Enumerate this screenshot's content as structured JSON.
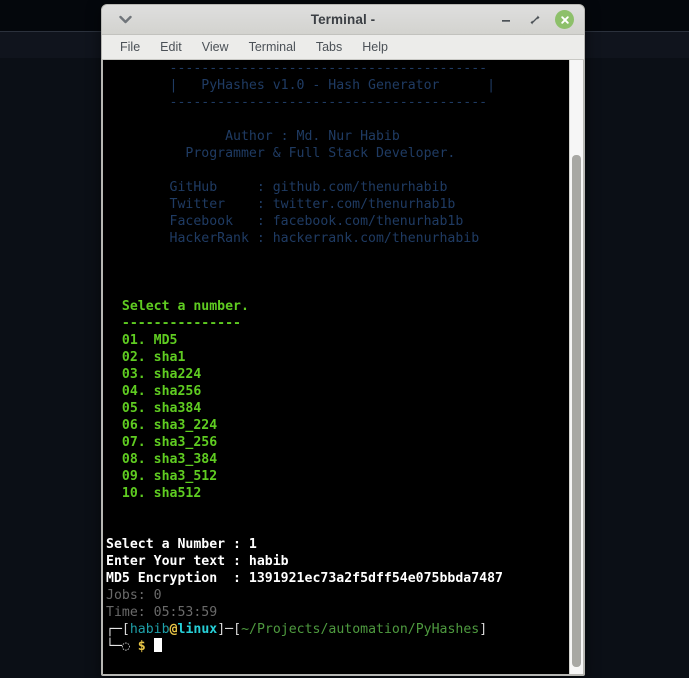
{
  "window": {
    "title": "Terminal -",
    "menu_icon": "chevron-down-icon",
    "buttons": {
      "minimize": "–",
      "maximize": "⤨",
      "close": "✕"
    }
  },
  "menubar": {
    "items": [
      {
        "label": "File"
      },
      {
        "label": "Edit"
      },
      {
        "label": "View"
      },
      {
        "label": "Terminal"
      },
      {
        "label": "Tabs"
      },
      {
        "label": "Help"
      }
    ]
  },
  "terminal": {
    "banner": {
      "rule_top": "        ----------------------------------------",
      "title_line": "        |   PyHashes v1.0 - Hash Generator      |",
      "rule_bottom": "        ----------------------------------------",
      "author": "               Author : Md. Nur Habib",
      "role": "          Programmer & Full Stack Developer."
    },
    "links": [
      {
        "label": "        GitHub     : ",
        "value": "github.com/thenurhabib"
      },
      {
        "label": "        Twitter    : ",
        "value": "twitter.com/thenurhab1b"
      },
      {
        "label": "        Facebook   : ",
        "value": "facebook.com/thenurhab1b"
      },
      {
        "label": "        HackerRank : ",
        "value": "hackerrank.com/thenurhabib"
      }
    ],
    "menu": {
      "heading": "  Select a number.",
      "rule": "  ---------------",
      "options": [
        "  01. MD5",
        "  02. sha1",
        "  03. sha224",
        "  04. sha256",
        "  05. sha384",
        "  06. sha3_224",
        "  07. sha3_256",
        "  08. sha3_384",
        "  09. sha3_512",
        "  10. sha512"
      ]
    },
    "session": {
      "select_prompt": "Select a Number : ",
      "select_value": "1",
      "text_prompt": "Enter Your text : ",
      "text_value": "habib",
      "result_label": "MD5 Encryption  : ",
      "result_value": "1391921ec73a2f5dff54e075bbda7487",
      "jobs_line": "Jobs: 0",
      "time_line": "Time: 05:53:59"
    },
    "prompt": {
      "branch_top": "┌─",
      "branch_bottom": "└─",
      "bracket_open": "[",
      "user": "habib",
      "at": "@",
      "host": "linux",
      "bracket_close": "]",
      "dash": "─",
      "path_open": "[",
      "path": "~/Projects/automation/PyHashes",
      "path_close": "]",
      "dot": "◌",
      "symbol": "$",
      "input": ""
    }
  },
  "colors": {
    "accent_green": "#5fcc21",
    "banner_blue": "#1f3b63",
    "prompt_cyan": "#27d0d8",
    "prompt_yellow": "#e8c547",
    "path_green": "#4e9a3f",
    "close_button": "#8dc06a",
    "terminal_bg": "#000000"
  }
}
